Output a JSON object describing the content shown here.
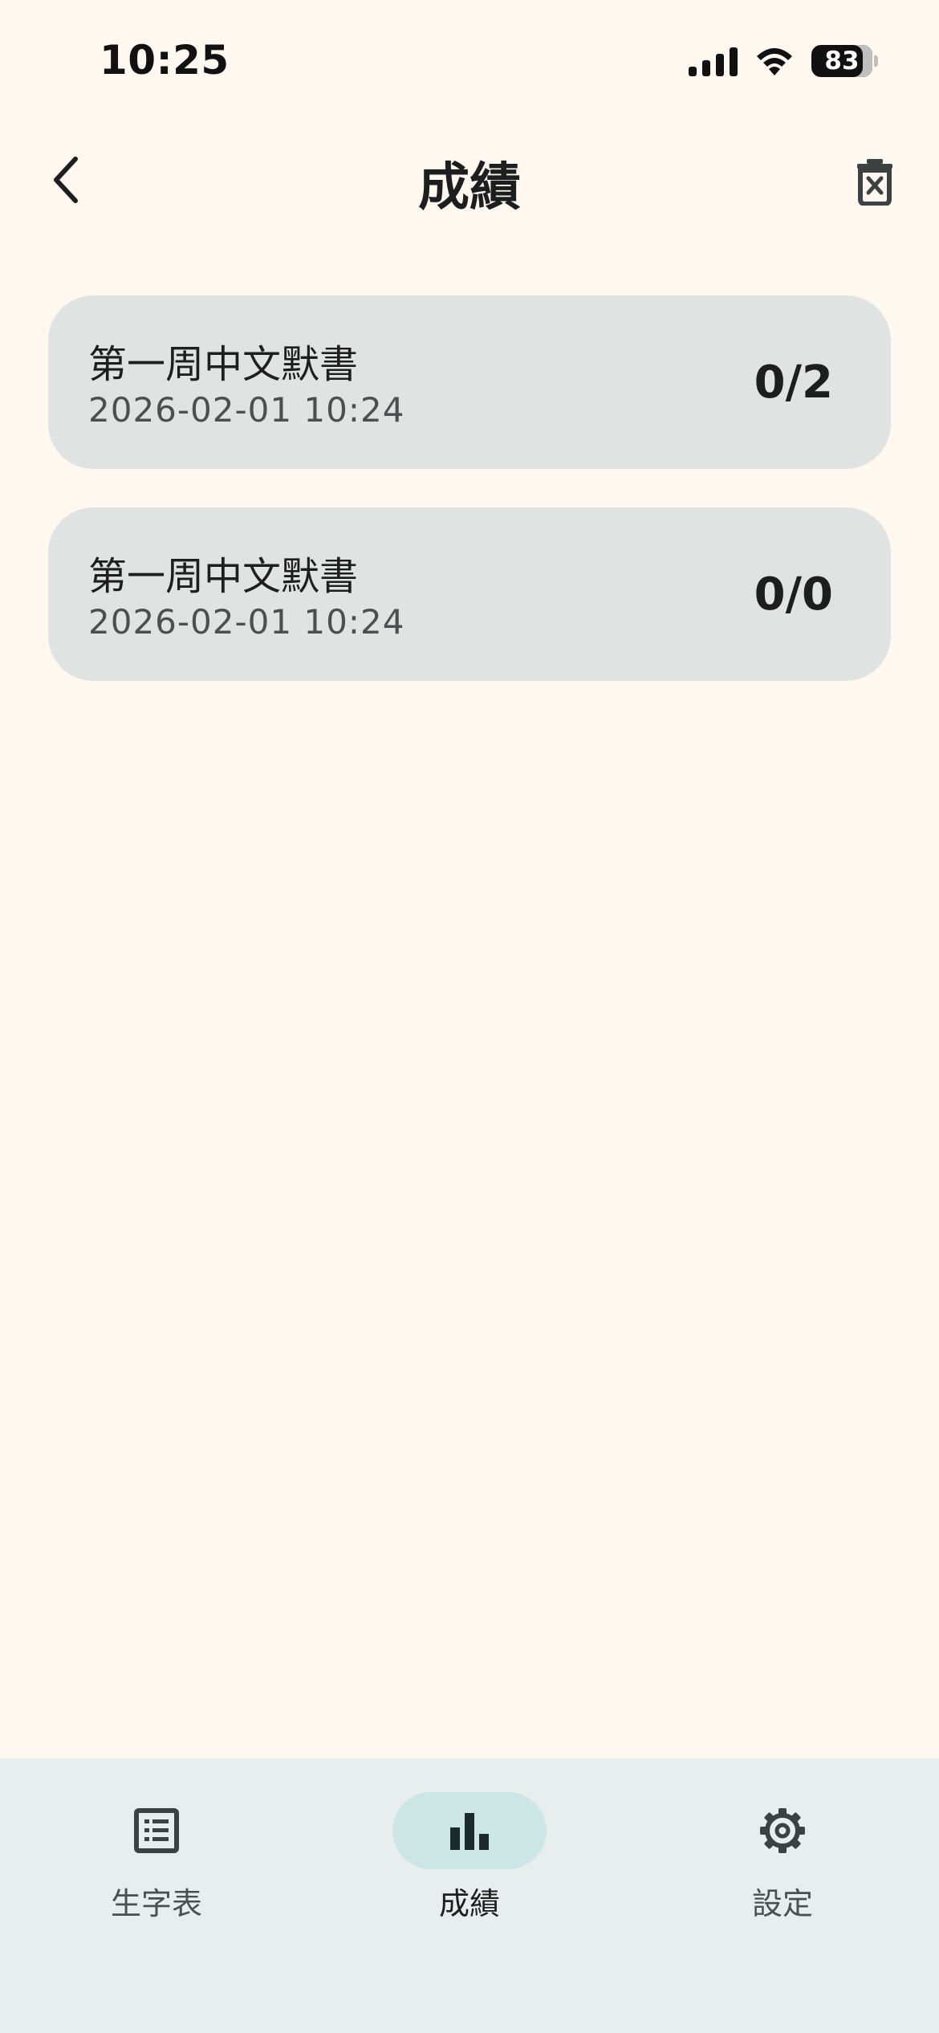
{
  "status_bar": {
    "time": "10:25",
    "battery": "83"
  },
  "header": {
    "title": "成績",
    "back_icon": "chevron-left-icon",
    "delete_icon": "trash-x-icon"
  },
  "results": [
    {
      "title": "第一周中文默書",
      "date": "2026-02-01 10:24",
      "score": "0/2"
    },
    {
      "title": "第一周中文默書",
      "date": "2026-02-01 10:24",
      "score": "0/0"
    }
  ],
  "bottom_nav": {
    "items": [
      {
        "label": "生字表",
        "icon": "list-icon",
        "active": false
      },
      {
        "label": "成績",
        "icon": "bar-chart-icon",
        "active": true
      },
      {
        "label": "設定",
        "icon": "gear-icon",
        "active": false
      }
    ]
  },
  "colors": {
    "background": "#fff8f1",
    "card": "#dfe4e2",
    "nav_background": "#e8eeed",
    "nav_active_pill": "#cce6e6"
  }
}
